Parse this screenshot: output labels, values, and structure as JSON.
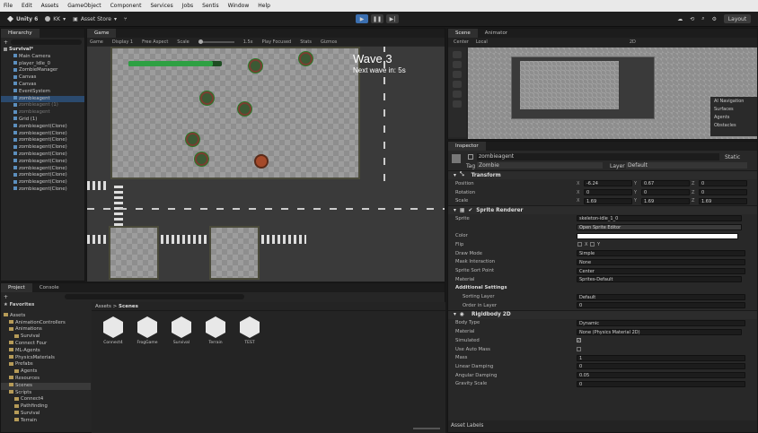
{
  "menubar": {
    "items": [
      "File",
      "Edit",
      "Assets",
      "GameObject",
      "Component",
      "Services",
      "Jobs",
      "Sentis",
      "Window",
      "Help"
    ]
  },
  "toolbar": {
    "app": "Unity 6",
    "account": "KK",
    "asset_store": "Asset Store",
    "layout": "Layout"
  },
  "hierarchy": {
    "tab": "Hierarchy",
    "scene": "Survival*",
    "items": [
      {
        "label": "Main Camera",
        "state": "normal"
      },
      {
        "label": "player_Idle_0",
        "state": "normal"
      },
      {
        "label": "ZombieManager",
        "state": "normal"
      },
      {
        "label": "Canvas",
        "state": "normal"
      },
      {
        "label": "Canvas",
        "state": "normal"
      },
      {
        "label": "EventSystem",
        "state": "normal"
      },
      {
        "label": "zombieagent",
        "state": "selected"
      },
      {
        "label": "zombieagent (1)",
        "state": "dim"
      },
      {
        "label": "zombieagent",
        "state": "dim"
      },
      {
        "label": "Grid (1)",
        "state": "normal"
      },
      {
        "label": "zombieagent(Clone)",
        "state": "normal"
      },
      {
        "label": "zombieagent(Clone)",
        "state": "normal"
      },
      {
        "label": "zombieagent(Clone)",
        "state": "normal"
      },
      {
        "label": "zombieagent(Clone)",
        "state": "normal"
      },
      {
        "label": "zombieagent(Clone)",
        "state": "normal"
      },
      {
        "label": "zombieagent(Clone)",
        "state": "normal"
      },
      {
        "label": "zombieagent(Clone)",
        "state": "normal"
      },
      {
        "label": "zombieagent(Clone)",
        "state": "normal"
      },
      {
        "label": "zombieagent(Clone)",
        "state": "normal"
      },
      {
        "label": "zombieagent(Clone)",
        "state": "normal"
      }
    ]
  },
  "game": {
    "tab": "Game",
    "toolbar": {
      "mode": "Game",
      "display": "Display 1",
      "aspect": "Free Aspect",
      "scale_label": "Scale",
      "scale_value": "1.5x",
      "play_focused": "Play Focused",
      "stats": "Stats",
      "gizmos": "Gizmos"
    },
    "wave": "Wave 3",
    "next_wave": "Next wave in: 5s",
    "health_fraction": 0.9
  },
  "scene": {
    "tabs": [
      "Scene",
      "Animator"
    ],
    "toolbar": {
      "pivot": "Center",
      "space": "Local",
      "mode": "2D"
    },
    "overlay_title": "AI Navigation",
    "overlay_items": [
      "Surfaces",
      "Agents",
      "Obstacles"
    ]
  },
  "project": {
    "tabs": [
      "Project",
      "Console"
    ],
    "favorites": "Favorites",
    "breadcrumb": [
      "Assets",
      "Scenes"
    ],
    "tree": [
      {
        "label": "Assets",
        "level": 0
      },
      {
        "label": "AnimationControllers",
        "level": 1
      },
      {
        "label": "Animations",
        "level": 1
      },
      {
        "label": "Survival",
        "level": 2
      },
      {
        "label": "Connect Four",
        "level": 1
      },
      {
        "label": "ML-Agents",
        "level": 1
      },
      {
        "label": "PhysicsMaterials",
        "level": 1
      },
      {
        "label": "Prefabs",
        "level": 1
      },
      {
        "label": "Agents",
        "level": 2
      },
      {
        "label": "Resources",
        "level": 1
      },
      {
        "label": "Scenes",
        "level": 1
      },
      {
        "label": "Scripts",
        "level": 1
      },
      {
        "label": "Connect4",
        "level": 2
      },
      {
        "label": "Pathfinding",
        "level": 2
      },
      {
        "label": "Survival",
        "level": 2
      },
      {
        "label": "Terrain",
        "level": 2
      }
    ],
    "scenes": [
      "Connect4",
      "FrogGame",
      "Survival",
      "Terrain",
      "TEST"
    ]
  },
  "inspector": {
    "tab": "Inspector",
    "object_name": "zombieagent",
    "static": "Static",
    "tag_label": "Tag",
    "tag": "Zombie",
    "layer_label": "Layer",
    "layer": "Default",
    "transform": {
      "title": "Transform",
      "position": {
        "label": "Position",
        "x": "-6.24",
        "y": "0.67",
        "z": "0"
      },
      "rotation": {
        "label": "Rotation",
        "x": "0",
        "y": "0",
        "z": "0"
      },
      "scale": {
        "label": "Scale",
        "x": "1.69",
        "y": "1.69",
        "z": "1.69"
      }
    },
    "sprite_renderer": {
      "title": "Sprite Renderer",
      "sprite_label": "Sprite",
      "sprite": "skeleton-idle_1_0",
      "open_editor": "Open Sprite Editor",
      "color_label": "Color",
      "flip_label": "Flip",
      "flip_x": "X",
      "flip_y": "Y",
      "draw_mode_label": "Draw Mode",
      "draw_mode": "Simple",
      "mask_label": "Mask Interaction",
      "mask": "None",
      "sort_label": "Sprite Sort Point",
      "sort": "Center",
      "material_label": "Material",
      "material": "Sprites-Default",
      "additional": "Additional Settings",
      "sorting_layer_label": "Sorting Layer",
      "sorting_layer": "Default",
      "order_label": "Order in Layer",
      "order": "0"
    },
    "rigidbody": {
      "title": "Rigidbody 2D",
      "body_type_label": "Body Type",
      "body_type": "Dynamic",
      "material_label": "Material",
      "material": "None (Physics Material 2D)",
      "simulated_label": "Simulated",
      "auto_mass_label": "Use Auto Mass",
      "mass_label": "Mass",
      "mass": "1",
      "linear_label": "Linear Damping",
      "linear": "0",
      "angular_label": "Angular Damping",
      "angular": "0.05",
      "gravity_label": "Gravity Scale",
      "gravity": "0"
    },
    "asset_labels": "Asset Labels"
  },
  "colors": {
    "accent": "#2b4a6e",
    "health": "#2ea043",
    "play": "#3b6fb0"
  }
}
